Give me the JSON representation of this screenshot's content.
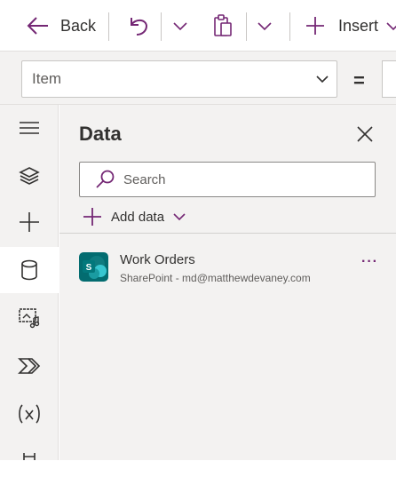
{
  "toolbar": {
    "back_label": "Back",
    "insert_label": "Insert",
    "brand_color": "#742774"
  },
  "formula": {
    "property_value": "Item",
    "equals": "="
  },
  "rail": {
    "items": [
      {
        "icon": "hamburger-menu-icon"
      },
      {
        "icon": "layers-icon"
      },
      {
        "icon": "plus-icon"
      },
      {
        "icon": "database-icon",
        "active": true
      },
      {
        "icon": "media-icon"
      },
      {
        "icon": "power-automate-icon"
      },
      {
        "icon": "variables-icon"
      },
      {
        "icon": "tools-icon"
      }
    ]
  },
  "pane": {
    "title": "Data",
    "search_placeholder": "Search",
    "add_data_label": "Add data",
    "sources": [
      {
        "name": "Work Orders",
        "subtitle": "SharePoint - md@matthewdevaney.com",
        "more": "···",
        "logo_letter": "S"
      }
    ]
  }
}
